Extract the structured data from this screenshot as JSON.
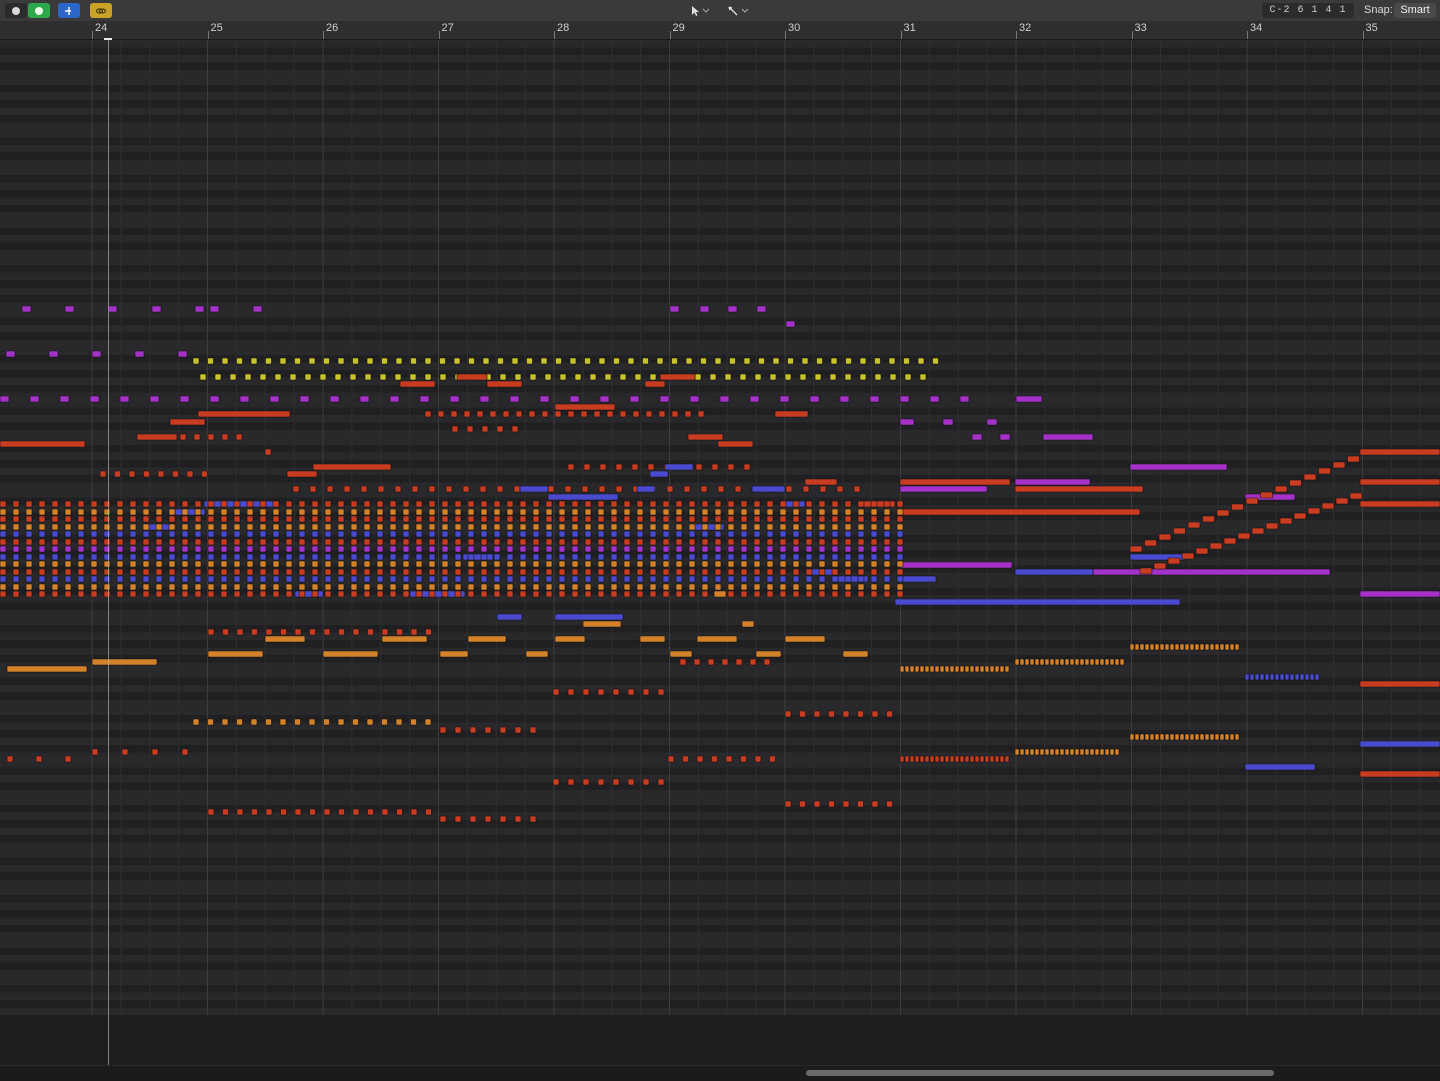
{
  "toolbar": {
    "buttons": [
      {
        "name": "midi-in-icon",
        "color": "#d8d8d8"
      },
      {
        "name": "midi-out-icon",
        "color": "#2ea84d"
      },
      {
        "name": "catch-icon",
        "color": "#2a67c8"
      },
      {
        "name": "link-icon",
        "color": "#c9a227"
      }
    ],
    "tools": [
      {
        "name": "pointer-tool-icon"
      },
      {
        "name": "pencil-tool-icon"
      }
    ],
    "lcd_value": "C-2  6 1 4 1",
    "snap_label": "Snap:",
    "snap_value": "Smart"
  },
  "ruler": {
    "bars": [
      "24",
      "25",
      "26",
      "27",
      "28",
      "29",
      "30",
      "31",
      "32",
      "33",
      "34",
      "35"
    ]
  },
  "colors": {
    "red": "#c83c22",
    "orange": "#d4822a",
    "yellow": "#c9c22a",
    "blue": "#4a4acf",
    "purple": "#a432c8",
    "magenta": "#b02fc6"
  }
}
